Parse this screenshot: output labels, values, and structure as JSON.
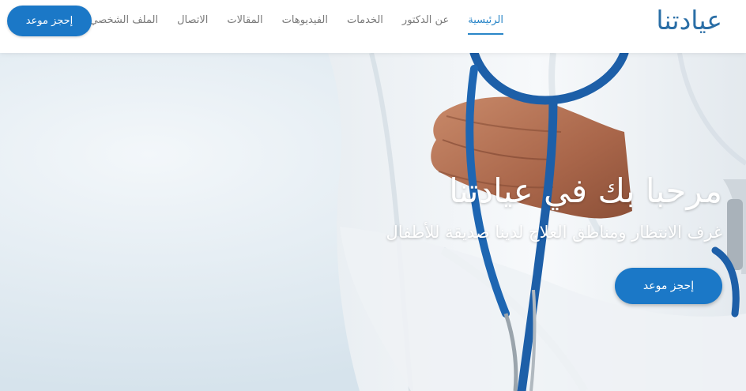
{
  "header": {
    "logo": "عيادتنا",
    "nav": [
      {
        "label": "الرئيسية",
        "active": true
      },
      {
        "label": "عن الدكتور",
        "active": false
      },
      {
        "label": "الخدمات",
        "active": false
      },
      {
        "label": "الفيديوهات",
        "active": false
      },
      {
        "label": "المقالات",
        "active": false
      },
      {
        "label": "الاتصال",
        "active": false
      },
      {
        "label": "الملف الشخصي",
        "active": false
      }
    ],
    "cta_label": "إحجز موعد"
  },
  "hero": {
    "title": "مرحبا بك في عيادتنا",
    "subtitle": "غرف الانتظار ومناطق العلاج لدينا صديقة للأطفال",
    "cta_label": "إحجز موعد",
    "image": "doctor-with-stethoscope-image"
  },
  "colors": {
    "accent": "#1b78c7",
    "logo": "#2a6ea6",
    "nav_text": "#7a7a7a",
    "nav_active": "#2a86c8"
  }
}
